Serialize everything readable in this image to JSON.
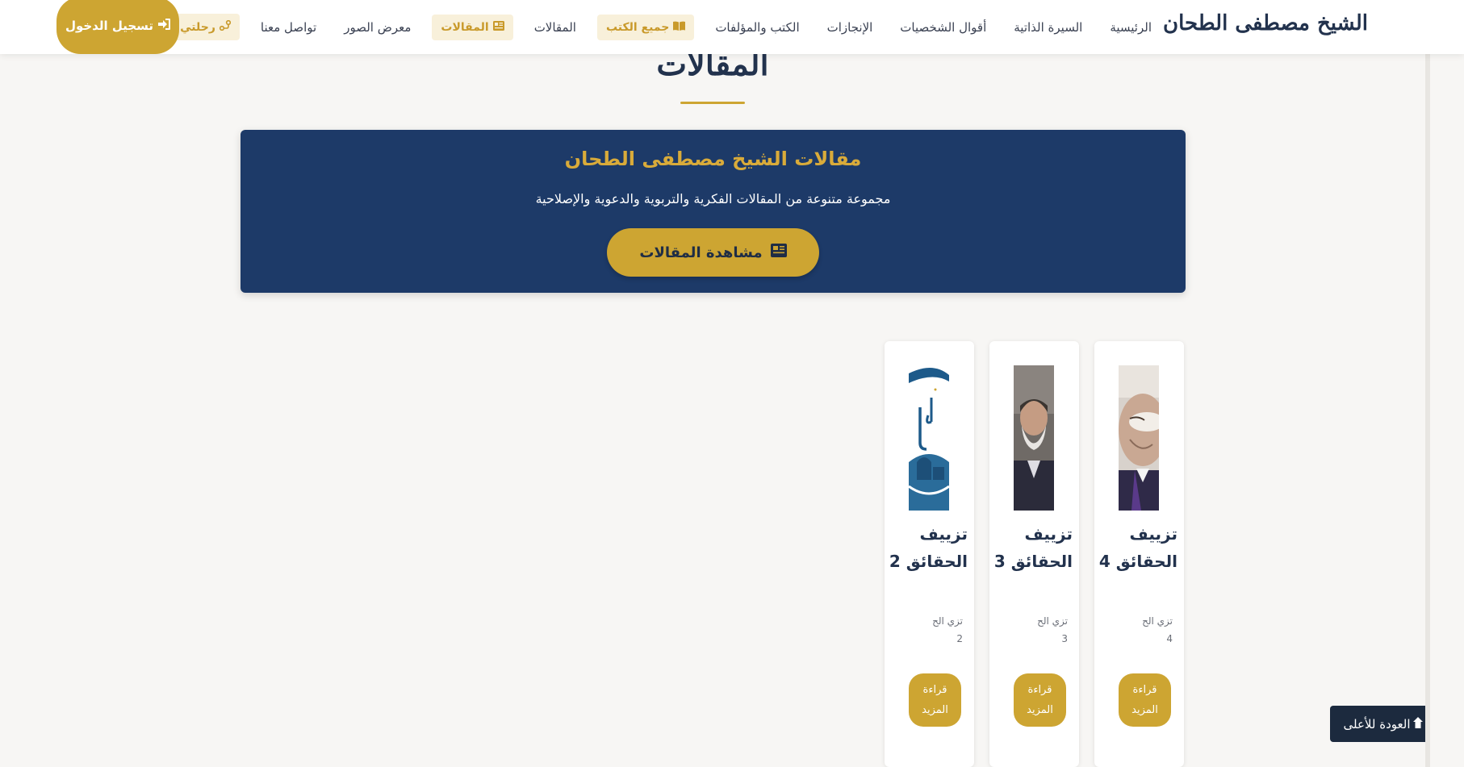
{
  "nav": {
    "brand": "الشيخ مصطفى الطحان",
    "links": [
      "الرئيسية",
      "السيرة الذاتية",
      "أقوال الشخصيات",
      "الإنجازات",
      "الكتب والمؤلفات"
    ],
    "pill_books": "جميع الكتب",
    "link_articles": "المقالات",
    "pill_articles": "المقالات",
    "link_gallery": "معرض الصور",
    "link_contact": "تواصل معنا",
    "pill_journey": "رحلتي التعليمية",
    "login": "تسجيل الدخول"
  },
  "section": {
    "title": "المقالات"
  },
  "banner": {
    "title": "مقالات الشيخ مصطفى الطحان",
    "subtitle": "مجموعة متنوعة من المقالات الفكرية والتربوية والدعوية والإصلاحية",
    "button": "مشاهدة المقالات"
  },
  "cards": [
    {
      "title": "تزييف الحقائق 4",
      "excerpt": "تزي الح 4",
      "button": "قراءة المزيد"
    },
    {
      "title": "تزييف الحقائق 3",
      "excerpt": "تزي الح 3",
      "button": "قراءة المزيد"
    },
    {
      "title": "تزييف الحقائق 2",
      "excerpt": "تزي الح 2",
      "button": "قراءة المزيد"
    }
  ],
  "back_to_top": "العودة للأعلى",
  "colors": {
    "accent": "#cda532",
    "navy": "#1d3a68",
    "dark": "#22324d"
  }
}
